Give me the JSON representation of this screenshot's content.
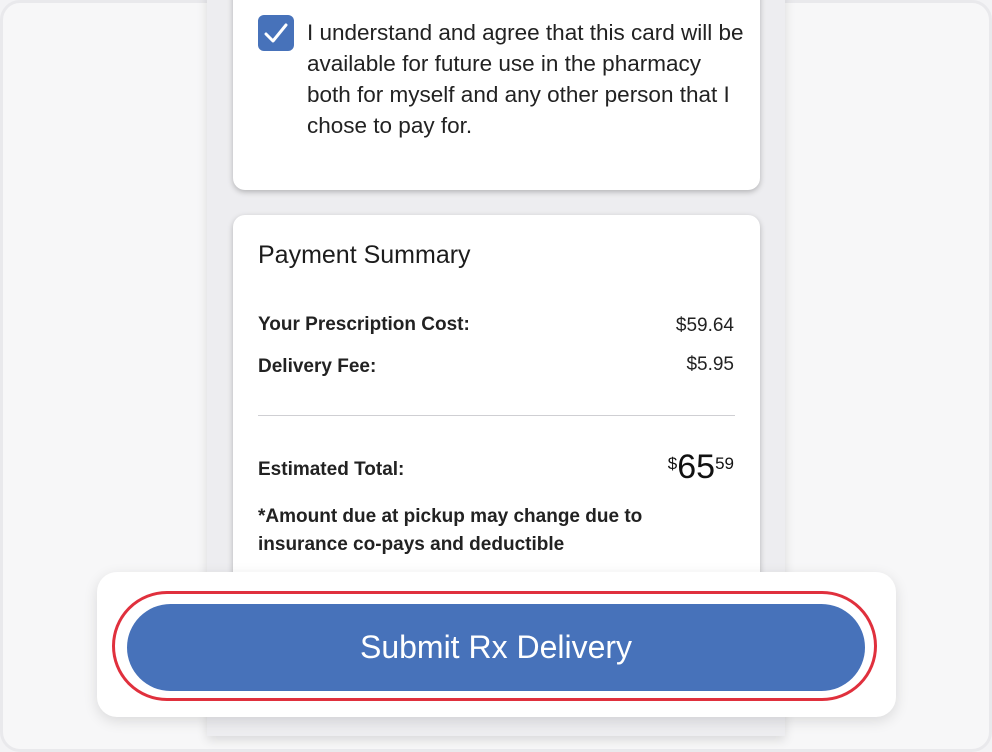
{
  "consent": {
    "checked": true,
    "text": "I understand and agree that this card will be available for future use in the pharmacy both for myself and any other person that I chose to pay for."
  },
  "payment_summary": {
    "title": "Payment Summary",
    "prescription_cost_label": "Your Prescription Cost:",
    "prescription_cost_value": "$59.64",
    "delivery_fee_label": "Delivery Fee:",
    "delivery_fee_value": "$5.95",
    "estimated_total_label": "Estimated Total:",
    "estimated_total_symbol": "$",
    "estimated_total_dollars": "65",
    "estimated_total_cents": "59",
    "disclaimer": "*Amount due at pickup may change due to insurance co-pays and deductible"
  },
  "submit": {
    "label": "Submit Rx Delivery"
  },
  "colors": {
    "accent": "#4772ba",
    "highlight_outline": "#e0303d"
  }
}
